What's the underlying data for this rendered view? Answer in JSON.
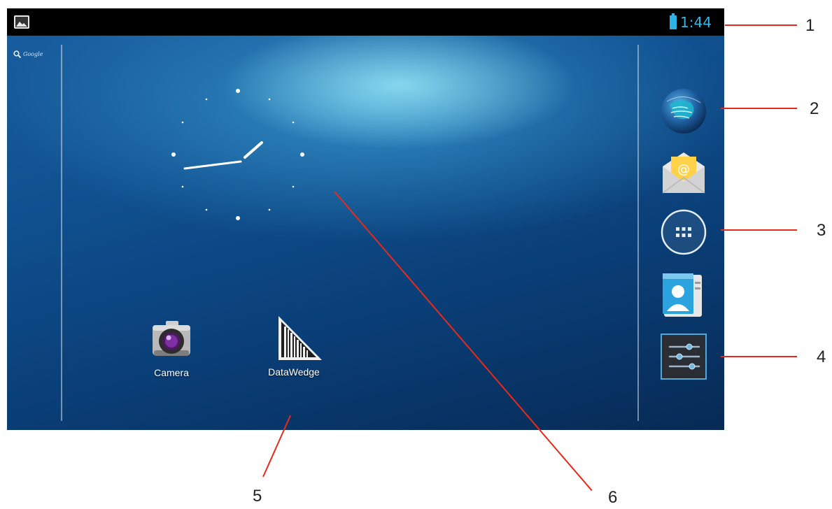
{
  "status_bar": {
    "time": "1:44",
    "left_icon": "gallery-icon",
    "right_icon": "battery-icon",
    "time_color": "#33b5e5"
  },
  "search": {
    "label": "Google",
    "icon": "search-icon"
  },
  "clock_widget": {
    "type": "analog-clock"
  },
  "home_apps": [
    {
      "label": "Camera",
      "icon": "camera-icon"
    },
    {
      "label": "DataWedge",
      "icon": "barcode-icon"
    }
  ],
  "dock": [
    {
      "icon": "browser-globe-icon"
    },
    {
      "icon": "email-icon"
    },
    {
      "icon": "all-apps-icon"
    },
    {
      "icon": "contacts-icon"
    },
    {
      "icon": "settings-icon"
    }
  ],
  "callouts": [
    "1",
    "2",
    "3",
    "4",
    "5",
    "6"
  ],
  "colors": {
    "callout_line": "#e82a1a",
    "status_bar": "#000000"
  }
}
